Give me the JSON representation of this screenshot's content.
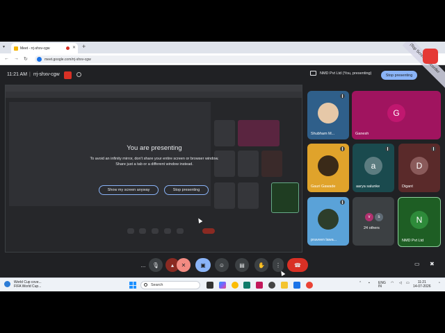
{
  "browser": {
    "tab_title": "Meet - rrj-shxv-cgw",
    "new_tab": "+",
    "url": "meet.google.com/rrj-shxv-cgw"
  },
  "meet": {
    "time": "11:21 AM",
    "separator": "|",
    "meeting_code": "rrj-shxv-cgw",
    "presenter": "NMD Pvt Ltd (You, presenting)",
    "stop_presenting_top": "Stop presenting"
  },
  "overlay": {
    "title": "You are presenting",
    "message_line1": "To avoid an infinity mirror, don't share your entire screen or browser window.",
    "message_line2": "Share just a tab or a different window instead.",
    "show_anyway": "Show my screen anyway",
    "stop_presenting": "Stop presenting"
  },
  "participants": [
    {
      "name": "Shubham M...",
      "type": "photo",
      "color": "#2f5f8a",
      "muted": true
    },
    {
      "name": "Ganesh",
      "initial": "G",
      "type": "avatar",
      "bg": "#a0145f",
      "avatar": "#c0176f",
      "muted": false
    },
    {
      "name": "Gauri Gawade",
      "type": "photo",
      "color": "#e0a32b",
      "muted": true
    },
    {
      "name": "aarya salunke",
      "initial": "a",
      "type": "avatar",
      "bg": "#1a4a4e",
      "avatar": "#5c7c80",
      "muted": true
    },
    {
      "name": "Digant",
      "initial": "D",
      "type": "avatar",
      "bg": "#5a2a2a",
      "avatar": "#8a5a5a",
      "muted": true
    },
    {
      "name": "praveen lawa...",
      "type": "photo",
      "color": "#5aa2d8",
      "muted": true
    },
    {
      "name": "24 others",
      "type": "others",
      "bg": "#3c4043",
      "a1": "v",
      "a2": "s",
      "c1": "#b0316f",
      "c2": "#5f6b75"
    },
    {
      "name": "NMD Pvt Ltd",
      "initial": "N",
      "type": "avatar",
      "bg": "#1e5e24",
      "avatar": "#2e8b3a",
      "muted": false,
      "active": true
    }
  ],
  "controls": {
    "more_left": "...",
    "mic": "mic",
    "camera": "camera-off",
    "present": "present",
    "emoji": "emoji",
    "captions": "captions",
    "hand": "raise-hand",
    "more": "more",
    "hangup": "hang-up"
  },
  "taskbar": {
    "news_line1": "World Cup cove...",
    "news_line2": "FIFA World Cup...",
    "search_label": "Search",
    "lang_line1": "ENG",
    "lang_line2": "IN",
    "clock_time": "11:21",
    "clock_date": "14-07-2026"
  },
  "watermark": {
    "text": "iTop Screen Recorder"
  },
  "colors": {
    "accent": "#8ab4f8",
    "hangup": "#d93025",
    "meet_bg": "#202124"
  }
}
